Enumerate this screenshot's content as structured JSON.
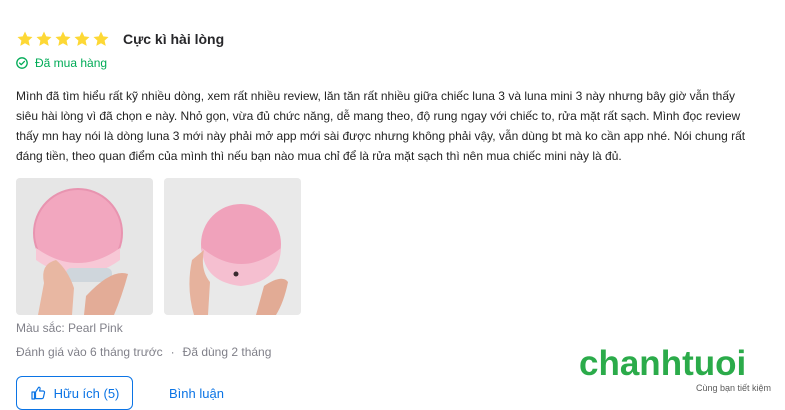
{
  "review": {
    "rating": 5,
    "rating_max": 5,
    "title": "Cực kì hài lòng",
    "verified_label": "Đã mua hàng",
    "content": "Mình đã tìm hiểu rất kỹ nhiều dòng, xem rất nhiều review, lăn tăn rất nhiều giữa chiếc luna 3 và luna mini 3 này nhưng bây giờ vẫn thấy siêu hài lòng vì đã chọn e này. Nhỏ gọn, vừa đủ chức năng, dễ mang theo, độ rung ngay với chiếc to, rửa mặt rất sạch. Mình đọc review thấy mn hay nói là dòng luna 3 mới này phải mở app mới sài được nhưng không phải vậy, vẫn dùng bt mà ko cần app nhé. Nói chung rất đáng tiền, theo quan điểm của mình thì nếu bạn nào mua chỉ để là rửa mặt sạch thì nên mua chiếc mini này là đủ.",
    "photos": [
      {
        "icon": "photo-front"
      },
      {
        "icon": "photo-back"
      }
    ],
    "color_label": "Màu sắc: Pearl Pink",
    "date_label": "Đánh giá vào 6 tháng trước",
    "separator": "·",
    "usage_label": "Đã dùng 2 tháng"
  },
  "actions": {
    "helpful_label": "Hữu ích (5)",
    "comment_label": "Bình luận"
  },
  "logo": {
    "word": "chanhtuoi",
    "tagline": "Cùng bạn tiết kiệm"
  },
  "colors": {
    "star": "#fdd835",
    "verified": "#00ab56",
    "link": "#0b74e5",
    "brand": "#2bab4a"
  }
}
